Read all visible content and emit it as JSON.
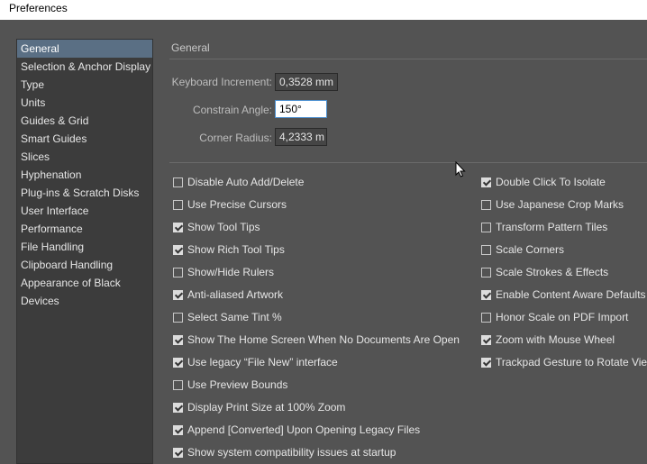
{
  "window": {
    "title": "Preferences"
  },
  "sidebar": {
    "items": [
      {
        "label": "General",
        "selected": true
      },
      {
        "label": "Selection & Anchor Display"
      },
      {
        "label": "Type"
      },
      {
        "label": "Units"
      },
      {
        "label": "Guides & Grid"
      },
      {
        "label": "Smart Guides"
      },
      {
        "label": "Slices"
      },
      {
        "label": "Hyphenation"
      },
      {
        "label": "Plug-ins & Scratch Disks"
      },
      {
        "label": "User Interface"
      },
      {
        "label": "Performance"
      },
      {
        "label": "File Handling"
      },
      {
        "label": "Clipboard Handling"
      },
      {
        "label": "Appearance of Black"
      },
      {
        "label": "Devices"
      }
    ]
  },
  "general": {
    "section_title": "General",
    "keyboard_increment": {
      "label": "Keyboard Increment:",
      "value": "0,3528 mm"
    },
    "constrain_angle": {
      "label": "Constrain Angle:",
      "value": "150°"
    },
    "corner_radius": {
      "label": "Corner Radius:",
      "value": "4,2333 m"
    }
  },
  "options_left": [
    {
      "label": "Disable Auto Add/Delete",
      "checked": false
    },
    {
      "label": "Use Precise Cursors",
      "checked": false
    },
    {
      "label": "Show Tool Tips",
      "checked": true
    },
    {
      "label": "Show Rich Tool Tips",
      "checked": true
    },
    {
      "label": "Show/Hide Rulers",
      "checked": false
    },
    {
      "label": "Anti-aliased Artwork",
      "checked": true
    },
    {
      "label": "Select Same Tint %",
      "checked": false
    },
    {
      "label": "Show The Home Screen When No Documents Are Open",
      "checked": true
    },
    {
      "label": "Use legacy “File New” interface",
      "checked": true
    },
    {
      "label": "Use Preview Bounds",
      "checked": false
    },
    {
      "label": "Display Print Size at 100% Zoom",
      "checked": true
    },
    {
      "label": "Append [Converted] Upon Opening Legacy Files",
      "checked": true
    },
    {
      "label": "Show system compatibility issues at startup",
      "checked": true
    }
  ],
  "options_right": [
    {
      "label": "Double Click To Isolate",
      "checked": true
    },
    {
      "label": "Use Japanese Crop Marks",
      "checked": false
    },
    {
      "label": "Transform Pattern Tiles",
      "checked": false
    },
    {
      "label": "Scale Corners",
      "checked": false
    },
    {
      "label": "Scale Strokes & Effects",
      "checked": false
    },
    {
      "label": "Enable Content Aware Defaults",
      "checked": true
    },
    {
      "label": "Honor Scale on PDF Import",
      "checked": false
    },
    {
      "label": "Zoom with Mouse Wheel",
      "checked": true
    },
    {
      "label": "Trackpad Gesture to Rotate View",
      "checked": true
    }
  ]
}
